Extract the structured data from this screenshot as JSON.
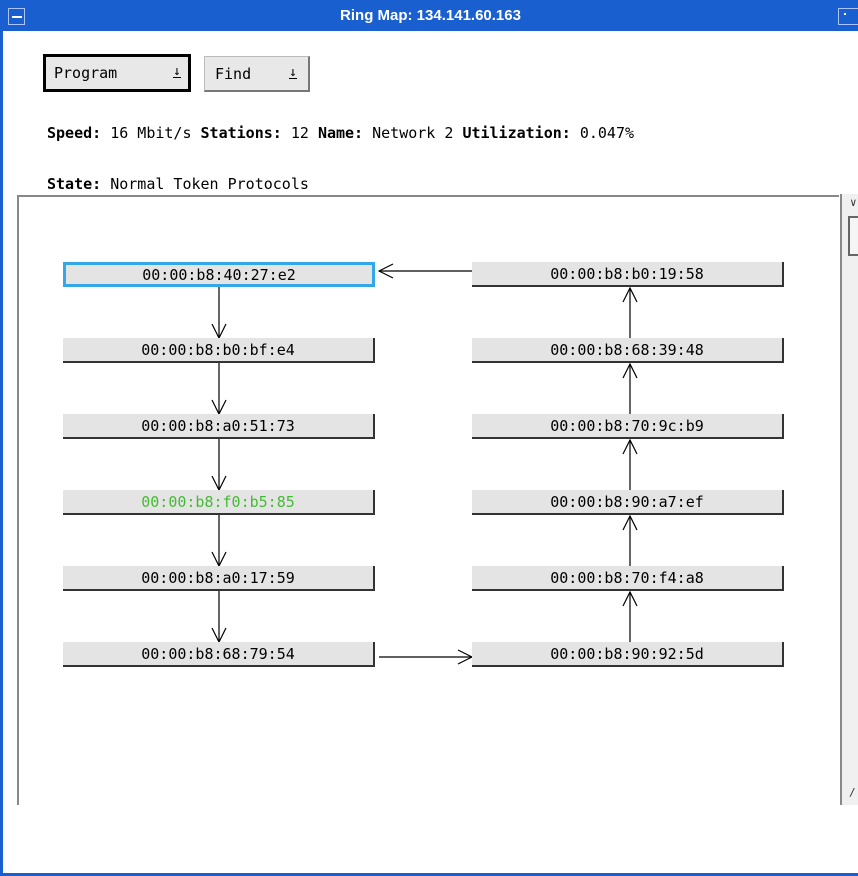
{
  "window": {
    "title": "Ring Map: 134.141.60.163"
  },
  "toolbar": {
    "program_label": "Program",
    "find_label": "Find",
    "dropdown_glyph": "↓"
  },
  "info": {
    "speed_label": "Speed:",
    "speed_value": "16 Mbit/s",
    "stations_label": "Stations:",
    "stations_value": "12",
    "name_label": "Name:",
    "name_value": "Network 2",
    "utilization_label": "Utilization:",
    "utilization_value": "0.047%",
    "state_label": "State:",
    "state_value": "Normal Token Protocols"
  },
  "nodes": [
    "00:00:b8:40:27:e2",
    "00:00:b8:b0:bf:e4",
    "00:00:b8:a0:51:73",
    "00:00:b8:f0:b5:85",
    "00:00:b8:a0:17:59",
    "00:00:b8:68:79:54",
    "00:00:b8:90:92:5d",
    "00:00:b8:70:f4:a8",
    "00:00:b8:90:a7:ef",
    "00:00:b8:70:9c:b9",
    "00:00:b8:68:39:48",
    "00:00:b8:b0:19:58"
  ],
  "colors": {
    "titlebar": "#1a5fd0",
    "selected_border": "#34a7e8",
    "highlight_text": "#44bb33"
  }
}
